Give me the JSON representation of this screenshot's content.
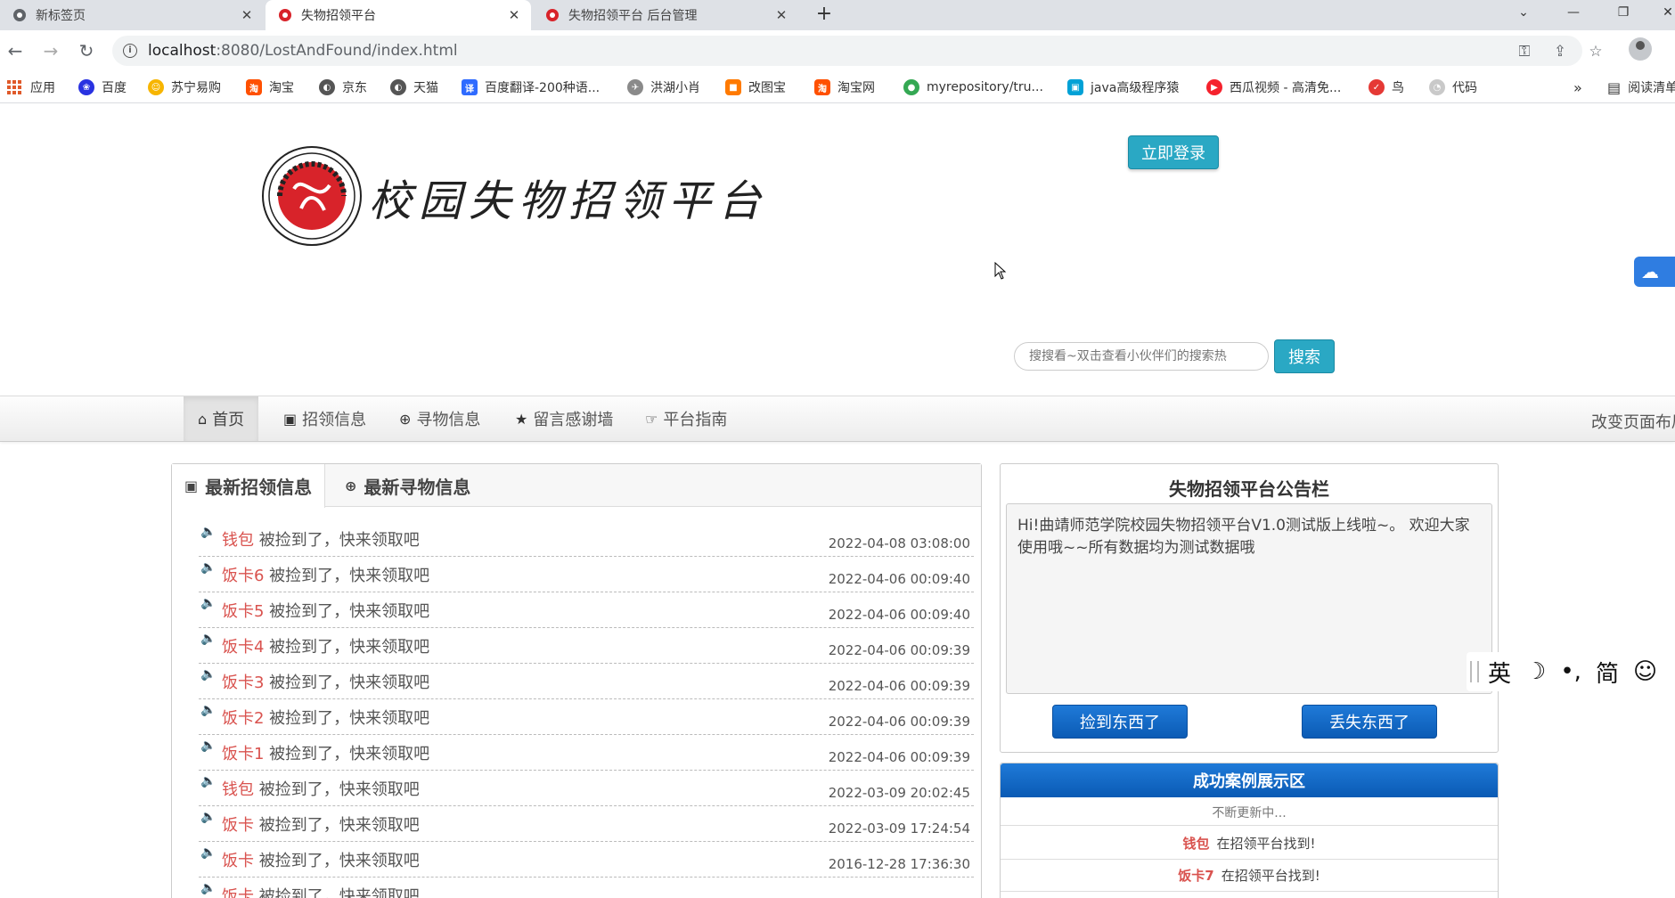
{
  "browser": {
    "tabs": [
      {
        "title": "新标签页",
        "close": "✕"
      },
      {
        "title": "失物招领平台",
        "close": "✕"
      },
      {
        "title": "失物招领平台 后台管理",
        "close": "✕"
      }
    ],
    "new_tab": "+",
    "url_host": "localhost",
    "url_rest": ":8080/LostAndFound/index.html",
    "bookmarks": [
      {
        "label": "应用",
        "icon": "apps-grid-icon"
      },
      {
        "label": "百度",
        "icon": "baidu-paw-icon",
        "color": "#2932e1"
      },
      {
        "label": "苏宁易购",
        "icon": "suning-icon",
        "color": "#f7b500"
      },
      {
        "label": "淘宝",
        "icon": "taobao-icon",
        "color": "#ff5000"
      },
      {
        "label": "京东",
        "icon": "globe-icon",
        "color": "#555555"
      },
      {
        "label": "天猫",
        "icon": "globe-icon",
        "color": "#555555"
      },
      {
        "label": "百度翻译-200种语...",
        "icon": "translate-icon",
        "color": "#2f6bff"
      },
      {
        "label": "洪湖小肖",
        "icon": "bird-icon",
        "color": "#8a8a8a"
      },
      {
        "label": "改图宝",
        "icon": "gaitubao-icon",
        "color": "#ff7a00"
      },
      {
        "label": "淘宝网",
        "icon": "taobao-icon",
        "color": "#ff5000"
      },
      {
        "label": "myrepository/tru...",
        "icon": "chrome-icon",
        "color": "#34a853"
      },
      {
        "label": "java高级程序猿",
        "icon": "bilibili-icon",
        "color": "#00a1d6"
      },
      {
        "label": "西瓜视频 - 高清免...",
        "icon": "xigua-icon",
        "color": "#f5222d"
      },
      {
        "label": "鸟",
        "icon": "bird-red-icon",
        "color": "#e53935"
      },
      {
        "label": "代码",
        "icon": "leaf-icon",
        "color": "#c9c9c9"
      }
    ],
    "bookmarks_more": "»",
    "reading_list": "阅读清单"
  },
  "header": {
    "site_title": "校园失物招领平台",
    "logo_alt_text": "HANDAN COLLEGE 1905",
    "login_button": "立即登录",
    "search_placeholder": "搜搜看~双击查看小伙伴们的搜索热",
    "search_button": "搜索"
  },
  "nav": {
    "items": [
      {
        "label": "首页",
        "icon": "home-icon"
      },
      {
        "label": "招领信息",
        "icon": "picture-icon"
      },
      {
        "label": "寻物信息",
        "icon": "zoom-icon"
      },
      {
        "label": "留言感谢墙",
        "icon": "star-icon"
      },
      {
        "label": "平台指南",
        "icon": "hand-point-icon"
      }
    ],
    "layout_link": "改变页面布局"
  },
  "panel": {
    "tabs": [
      "最新招领信息",
      "最新寻物信息"
    ],
    "notices": [
      {
        "item": "钱包",
        "msg": " 被捡到了，快来领取吧",
        "date": "2022-04-08 03:08:00"
      },
      {
        "item": "饭卡6",
        "msg": " 被捡到了，快来领取吧",
        "date": "2022-04-06 00:09:40"
      },
      {
        "item": "饭卡5",
        "msg": " 被捡到了，快来领取吧",
        "date": "2022-04-06 00:09:40"
      },
      {
        "item": "饭卡4",
        "msg": " 被捡到了，快来领取吧",
        "date": "2022-04-06 00:09:39"
      },
      {
        "item": "饭卡3",
        "msg": " 被捡到了，快来领取吧",
        "date": "2022-04-06 00:09:39"
      },
      {
        "item": "饭卡2",
        "msg": " 被捡到了，快来领取吧",
        "date": "2022-04-06 00:09:39"
      },
      {
        "item": "饭卡1",
        "msg": " 被捡到了，快来领取吧",
        "date": "2022-04-06 00:09:39"
      },
      {
        "item": "钱包",
        "msg": " 被捡到了，快来领取吧",
        "date": "2022-03-09 20:02:45"
      },
      {
        "item": "饭卡",
        "msg": " 被捡到了，快来领取吧",
        "date": "2022-03-09 17:24:54"
      },
      {
        "item": "饭卡",
        "msg": " 被捡到了，快来领取吧",
        "date": "2016-12-28 17:36:30"
      },
      {
        "item": "饭卡",
        "msg": " 被捡到了，快来领取吧",
        "date": ""
      }
    ]
  },
  "notice_board": {
    "title": "失物招领平台公告栏",
    "text": "Hi!曲靖师范学院校园失物招领平台V1.0测试版上线啦~。 欢迎大家使用哦~~所有数据均为测试数据哦",
    "found_button": "捡到东西了",
    "lost_button": "丢失东西了"
  },
  "success": {
    "title": "成功案例展示区",
    "updating": "不断更新中...",
    "cases": [
      {
        "item": "钱包",
        "msg": "在招领平台找到!"
      },
      {
        "item": "饭卡7",
        "msg": "在招领平台找到!"
      }
    ]
  },
  "ime": {
    "keys": [
      "英",
      "☽",
      "•,",
      "简",
      "☺"
    ]
  },
  "colors": {
    "accent_teal": "#2aa8c4",
    "accent_blue": "#0b5bb5",
    "item_red": "#d9534f"
  }
}
